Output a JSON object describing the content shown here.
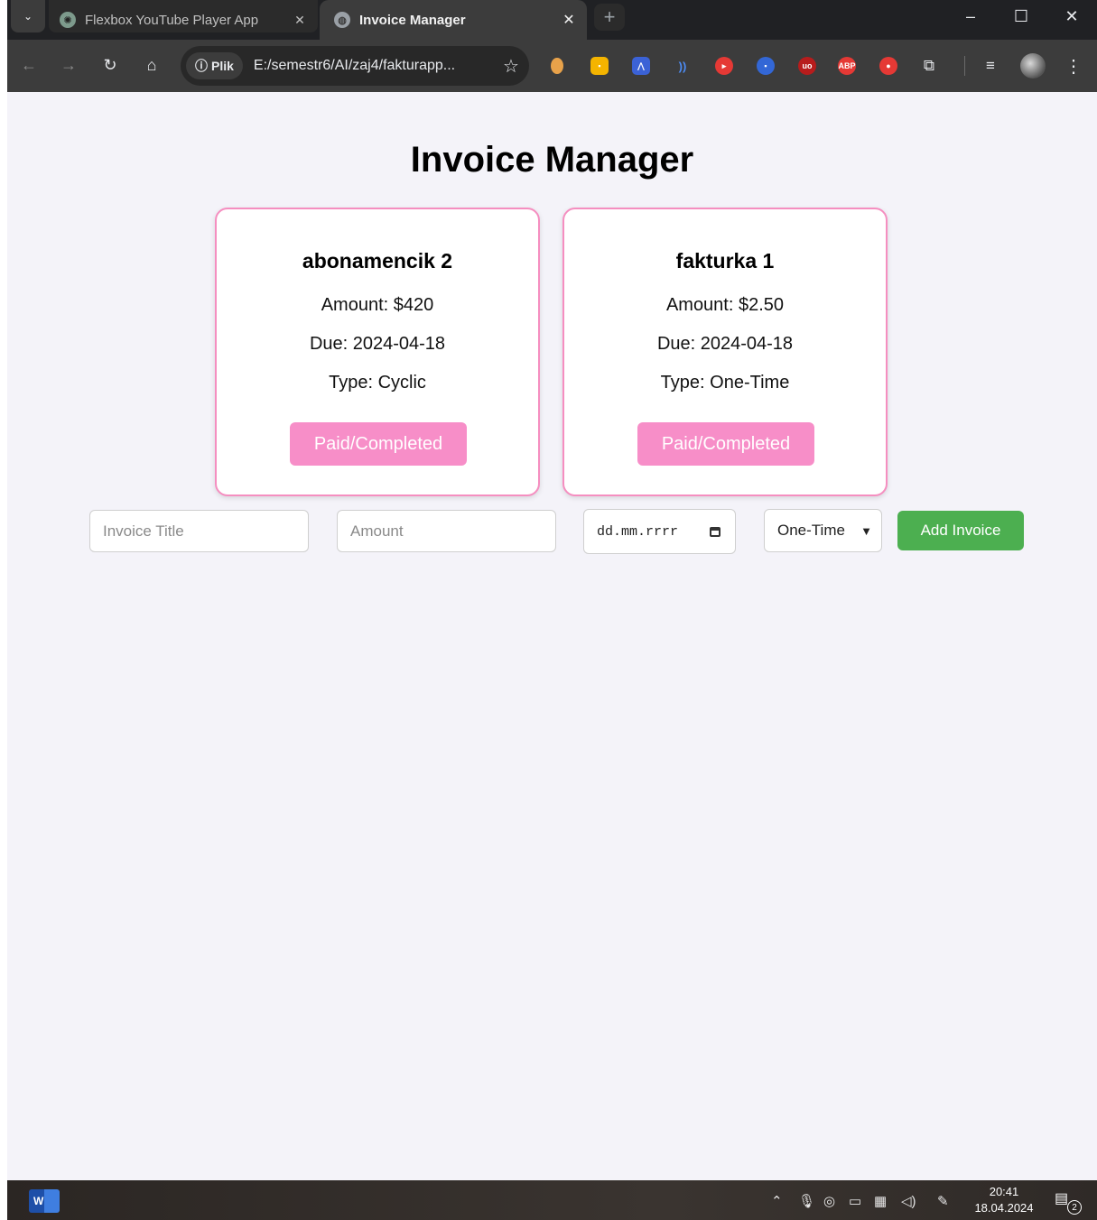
{
  "browser": {
    "tabs": [
      {
        "title": "Flexbox YouTube Player App",
        "close": "✕"
      },
      {
        "title": "Invoice Manager",
        "close": "✕"
      }
    ],
    "new_tab": "+",
    "window": {
      "minimize": "–",
      "maximize": "☐",
      "close": "✕"
    },
    "address": {
      "chip": "Plik",
      "url": "E:/semestr6/AI/zaj4/fakturapp..."
    }
  },
  "page": {
    "title": "Invoice Manager",
    "invoices": [
      {
        "title": "abonamencik 2",
        "amount_label": "Amount: ",
        "amount": "$420",
        "due_label": "Due: ",
        "due": "2024-04-18",
        "type_label": "Type: ",
        "type": "Cyclic",
        "status_button": "Paid/Completed"
      },
      {
        "title": "fakturka 1",
        "amount_label": "Amount: ",
        "amount": "$2.50",
        "due_label": "Due: ",
        "due": "2024-04-18",
        "type_label": "Type: ",
        "type": "One-Time",
        "status_button": "Paid/Completed"
      }
    ],
    "form": {
      "title_placeholder": "Invoice Title",
      "amount_placeholder": "Amount",
      "date_placeholder": "dd.mm.rrrr",
      "type_selected": "One-Time",
      "add_button": "Add Invoice"
    }
  },
  "taskbar": {
    "time": "20:41",
    "date": "18.04.2024",
    "notifications": "2"
  },
  "colors": {
    "card_border": "#f58ec0",
    "paid_button": "#f78ec8",
    "add_button": "#4caf50",
    "page_bg": "#f4f3f9"
  }
}
